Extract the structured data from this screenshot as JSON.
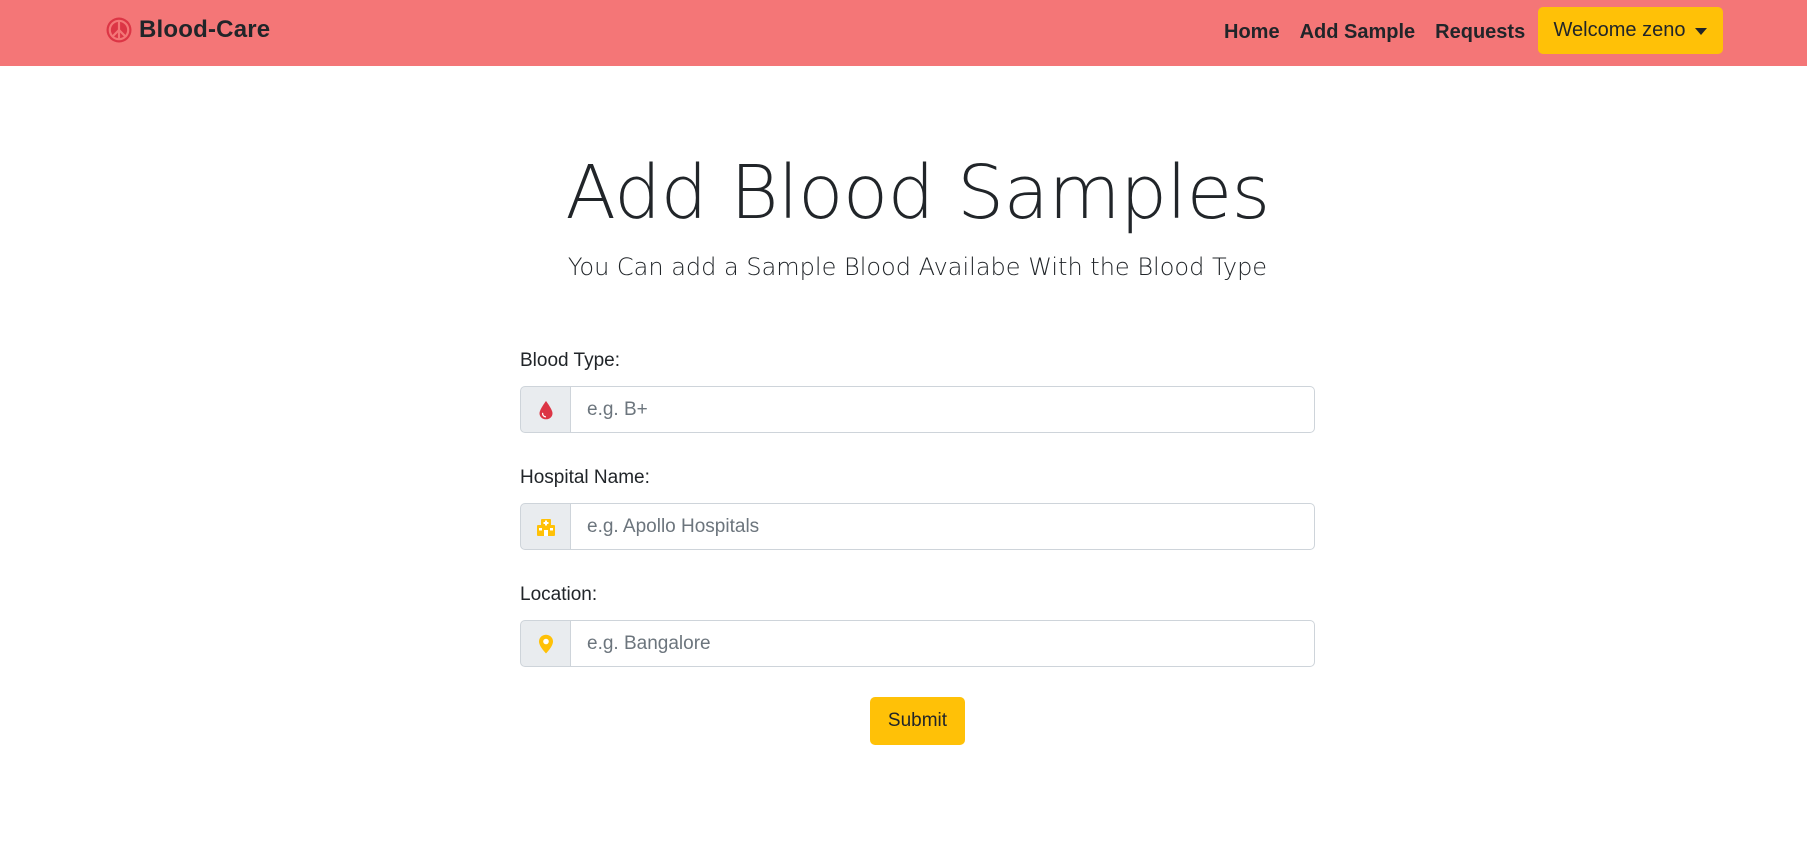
{
  "navbar": {
    "brand_name": "Blood-Care",
    "brand_icon": "peace-icon",
    "links": [
      "Home",
      "Add Sample",
      "Requests"
    ],
    "user_menu_label": "Welcome zeno",
    "background": "#f47677"
  },
  "header": {
    "title": "Add Blood Samples",
    "subtitle": "You Can add a Sample Blood Availabe With the Blood Type"
  },
  "form": {
    "fields": [
      {
        "label": "Blood Type:",
        "placeholder": "e.g. B+",
        "icon": "blood-drop-icon",
        "value": ""
      },
      {
        "label": "Hospital Name:",
        "placeholder": "e.g. Apollo Hospitals",
        "icon": "hospital-icon",
        "value": ""
      },
      {
        "label": "Location:",
        "placeholder": "e.g. Bangalore",
        "icon": "location-pin-icon",
        "value": ""
      }
    ],
    "submit_label": "Submit"
  },
  "colors": {
    "accent": "#ffc107",
    "brand_red": "#dc3545",
    "navbar": "#f47677"
  }
}
